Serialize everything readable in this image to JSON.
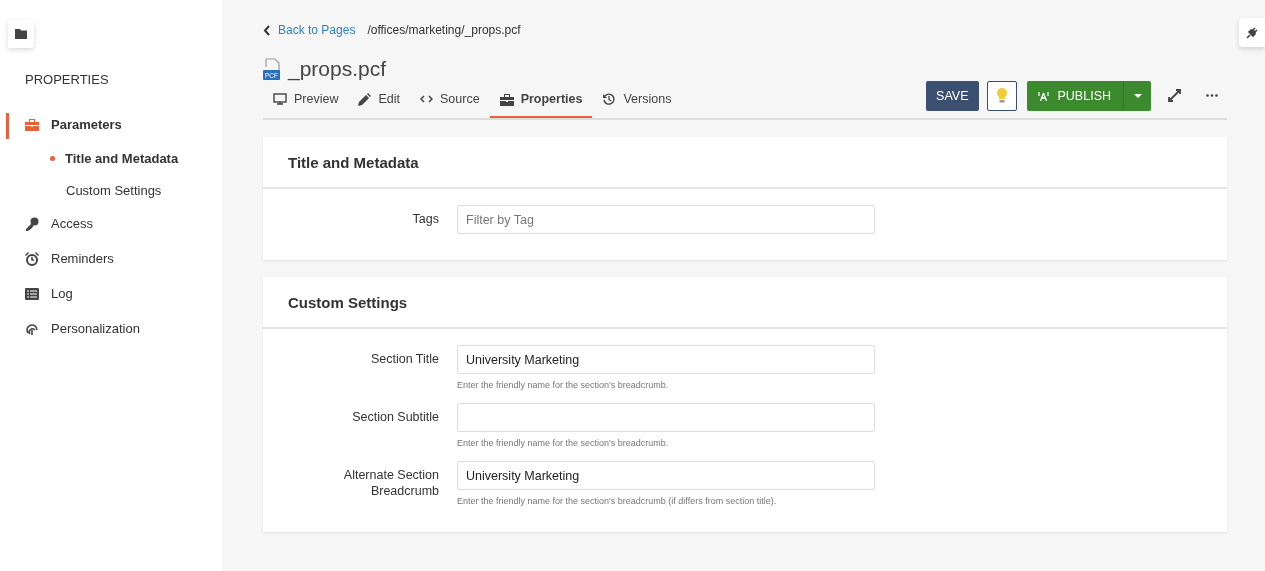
{
  "sidebar": {
    "heading": "PROPERTIES",
    "items": [
      {
        "label": "Parameters",
        "selected": true,
        "children": [
          {
            "label": "Title and Metadata",
            "selected": true
          },
          {
            "label": "Custom Settings",
            "selected": false
          }
        ]
      },
      {
        "label": "Access",
        "selected": false
      },
      {
        "label": "Reminders",
        "selected": false
      },
      {
        "label": "Log",
        "selected": false
      },
      {
        "label": "Personalization",
        "selected": false
      }
    ]
  },
  "breadcrumb": {
    "back": "Back to Pages",
    "path": "/offices/marketing/_props.pcf"
  },
  "file": {
    "badge": "PCF",
    "name": "_props.pcf"
  },
  "tabs": [
    {
      "label": "Preview",
      "selected": false
    },
    {
      "label": "Edit",
      "selected": false
    },
    {
      "label": "Source",
      "selected": false
    },
    {
      "label": "Properties",
      "selected": true
    },
    {
      "label": "Versions",
      "selected": false
    }
  ],
  "toolbar": {
    "save": "SAVE",
    "publish": "PUBLISH"
  },
  "cards": [
    {
      "title": "Title and Metadata",
      "fields": [
        {
          "label": "Tags",
          "placeholder": "Filter by Tag"
        }
      ]
    },
    {
      "title": "Custom Settings",
      "fields": [
        {
          "label": "Section Title",
          "value": "University Marketing",
          "help": "Enter the friendly name for the section's breadcrumb."
        },
        {
          "label": "Section Subtitle",
          "help": "Enter the friendly name for the section's breadcrumb."
        },
        {
          "label": "Alternate Section Breadcrumb",
          "value": "University Marketing",
          "help": "Enter the friendly name for the section's breadcrumb (if differs from section title)."
        }
      ]
    }
  ]
}
